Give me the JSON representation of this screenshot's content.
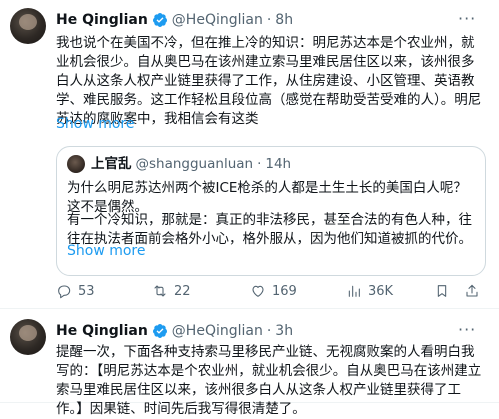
{
  "tweet1": {
    "name": "He Qinglian",
    "handle": "@HeQinglian",
    "separator": "·",
    "time": "8h",
    "text": "我也说个在美国不冷，但在推上冷的知识：明尼苏达本是个农业州，就业机会很少。自从奥巴马在该州建立索马里难民居住区以来，该州很多白人从这条人权产业链里获得了工作，从住房建设、小区管理、英语教学、难民服务。这工作轻松且段位高（感觉在帮助受苦受难的人）。明尼苏达的腐败案中，我相信会有这类",
    "show_more": "Show more",
    "quote": {
      "name": "上官乱",
      "handle": "@shangguanluan",
      "separator": "·",
      "time": "14h",
      "text1": "为什么明尼苏达州两个被ICE枪杀的人都是土生土长的美国白人呢？这不是偶然。",
      "text2": "有一个冷知识，那就是：真正的非法移民，甚至合法的有色人种，往往在执法者面前会格外小心，格外服从，因为他们知道被抓的代价。",
      "show_more": "Show more"
    },
    "actions": {
      "replies": "53",
      "reposts": "22",
      "likes": "169",
      "views": "36K"
    }
  },
  "tweet2": {
    "name": "He Qinglian",
    "handle": "@HeQinglian",
    "separator": "·",
    "time": "3h",
    "text": "提醒一次，下面各种支持索马里移民产业链、无视腐败案的人看明白我写的：【明尼苏达本是个农业州，就业机会很少。自从奥巴马在该州建立索马里难民居住区以来，该州很多白人从这条人权产业链里获得了工作。】因果链、时间先后我写得很清楚了。"
  },
  "colors": {
    "verified": "#1d9bf0",
    "link": "#1d9bf0",
    "secondary_text": "#536471",
    "border": "#cfd9de"
  },
  "icons": [
    "verified-badge-icon",
    "more-icon",
    "reply-icon",
    "repost-icon",
    "like-icon",
    "views-icon",
    "bookmark-icon",
    "share-icon"
  ]
}
